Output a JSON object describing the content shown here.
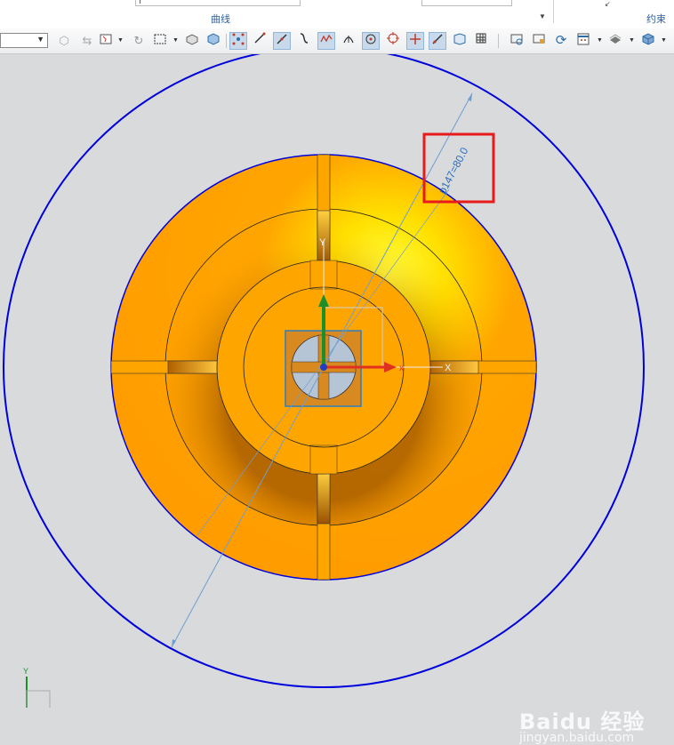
{
  "ribbon": {
    "curve_group_label": "曲线",
    "constraint_group_label": "约束"
  },
  "toolbar": {
    "selection_filter_value": "",
    "tools": [
      "filter-icon",
      "snap-icon",
      "select-box-icon",
      "rotate-icon",
      "rectangle-icon",
      "block-icon",
      "solid-icon",
      "points-icon",
      "line-icon",
      "slope-icon",
      "curve-icon",
      "spline-icon",
      "arc-icon",
      "center-point-icon",
      "circle-icon",
      "cross-icon",
      "tangent-icon",
      "view-icon",
      "grid-icon",
      "screenshot-icon",
      "frame-icon",
      "refresh-icon",
      "layout-icon",
      "layer-icon",
      "cube-icon"
    ]
  },
  "viewport": {
    "dimension_text": "p147=80.0",
    "x_axis_label": "X",
    "y_axis_label": "Y",
    "part_color": "#ffa500",
    "outer_circle_color": "#0000dd",
    "highlight_color": "#e81a1a"
  },
  "watermark": {
    "brand": "Baidu 经验",
    "url": "jingyan.baidu.com"
  }
}
